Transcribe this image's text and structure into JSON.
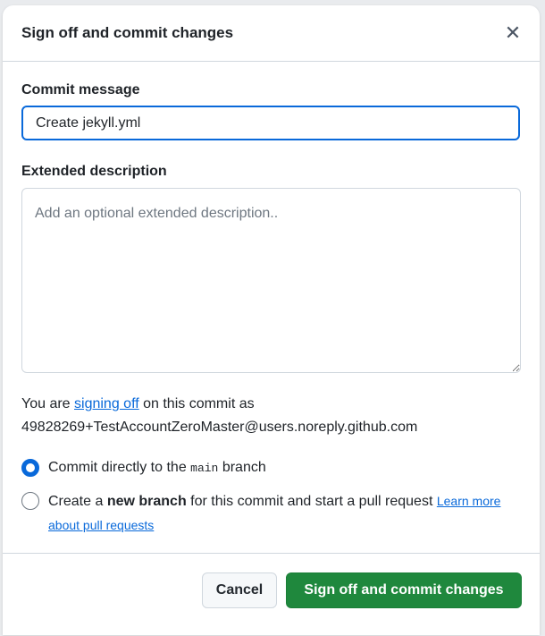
{
  "dialog": {
    "title": "Sign off and commit changes",
    "close_icon": "close-icon",
    "close_glyph": "✕"
  },
  "commit_message": {
    "label": "Commit message",
    "value": "Create jekyll.yml"
  },
  "extended_description": {
    "label": "Extended description",
    "value": "",
    "placeholder": "Add an optional extended description.."
  },
  "signoff": {
    "prefix": "You are ",
    "link": "signing off",
    "suffix": " on this commit as",
    "email": "49828269+TestAccountZeroMaster@users.noreply.github.com"
  },
  "options": {
    "direct": {
      "prefix": "Commit directly to the ",
      "branch": "main",
      "suffix": " branch",
      "checked": true
    },
    "new_branch": {
      "prefix": "Create a ",
      "bold": "new branch",
      "suffix": " for this commit and start a pull request ",
      "link": "Learn more about pull requests",
      "checked": false
    }
  },
  "footer": {
    "cancel_label": "Cancel",
    "commit_label": "Sign off and commit changes"
  },
  "colors": {
    "accent": "#0969da",
    "primary_button": "#1f883d",
    "border": "#d0d7de"
  }
}
